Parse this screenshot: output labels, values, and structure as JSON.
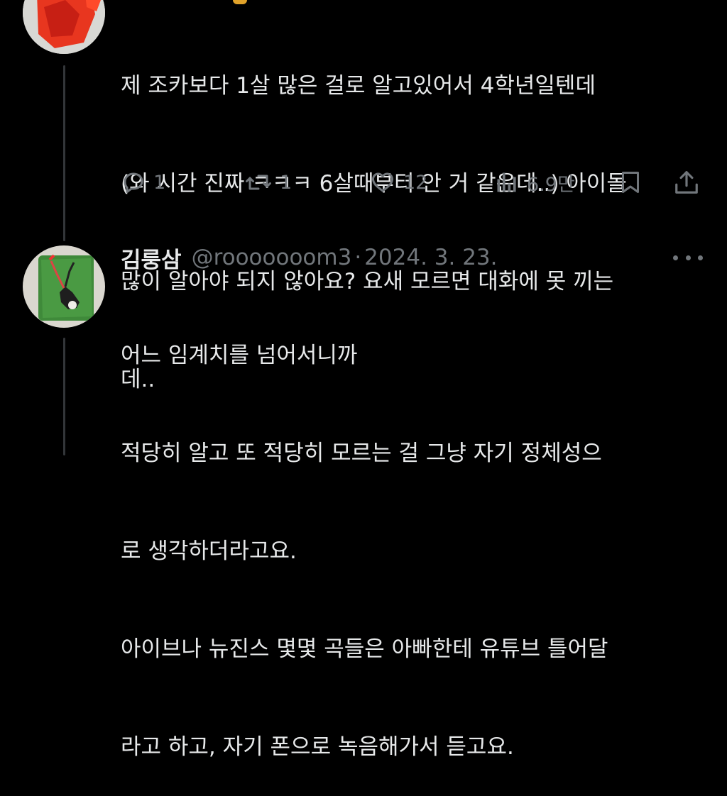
{
  "tweet1": {
    "lines": [
      "제 조카보다 1살 많은 걸로 알고있어서 4학년일텐데",
      "(와 시간 진짜 ㅋㅋㅋ 6살때부터 안 거 같은데..) 아이돌",
      "많이 알아야 되지 않아요? 요새 모르면 대화에 못 끼는",
      "데.."
    ],
    "actions": {
      "reply_count": "1",
      "retweet_count": "1",
      "like_count": "12",
      "views_count": "6.9만"
    }
  },
  "tweet2": {
    "display_name": "김룽삼",
    "handle": "@rooooooom3",
    "separator": "·",
    "date": "2024. 3. 23.",
    "lines": [
      "어느 임계치를 넘어서니까",
      "적당히 알고 또 적당히 모르는 걸 그냥 자기 정체성으",
      "로 생각하더라고요.",
      "아이브나 뉴진스 몇몇 곡들은 아빠한테 유튜브 틀어달",
      "라고 하고, 자기 폰으로 녹음해가서 듣고요."
    ]
  },
  "colors": {
    "background": "#000000",
    "text": "#e7e9ea",
    "secondary": "#71767b",
    "thread_line": "#333639"
  }
}
